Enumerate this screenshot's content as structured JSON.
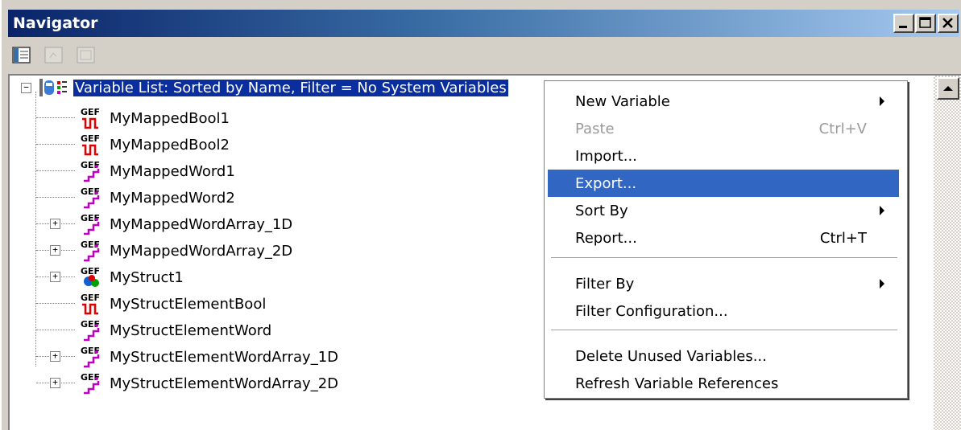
{
  "window": {
    "title": "Navigator",
    "controls": [
      "minimize-icon",
      "maximize-icon",
      "close-icon"
    ]
  },
  "toolbar": {
    "buttons": [
      "tree-view-icon",
      "toolbar-disabled-icon",
      "toolbar-disabled-icon"
    ]
  },
  "tree": {
    "root_label": "Variable List: Sorted by Name, Filter = No System Variables",
    "items": [
      {
        "label": "MyMappedBool1",
        "icon": "bool-variable-icon",
        "expandable": false
      },
      {
        "label": "MyMappedBool2",
        "icon": "bool-variable-icon",
        "expandable": false
      },
      {
        "label": "MyMappedWord1",
        "icon": "word-variable-icon",
        "expandable": false
      },
      {
        "label": "MyMappedWord2",
        "icon": "word-variable-icon",
        "expandable": false
      },
      {
        "label": "MyMappedWordArray_1D",
        "icon": "word-variable-icon",
        "expandable": true
      },
      {
        "label": "MyMappedWordArray_2D",
        "icon": "word-variable-icon",
        "expandable": true
      },
      {
        "label": "MyStruct1",
        "icon": "struct-variable-icon",
        "expandable": true
      },
      {
        "label": "MyStructElementBool",
        "icon": "bool-variable-icon",
        "expandable": false
      },
      {
        "label": "MyStructElementWord",
        "icon": "word-variable-icon",
        "expandable": false
      },
      {
        "label": "MyStructElementWordArray_1D",
        "icon": "word-variable-icon",
        "expandable": true
      },
      {
        "label": "MyStructElementWordArray_2D",
        "icon": "word-variable-icon",
        "expandable": true
      }
    ],
    "icon_text": "GEF"
  },
  "context_menu": {
    "items": [
      {
        "label": "New Variable",
        "shortcut": "",
        "submenu": true,
        "disabled": false,
        "highlighted": false
      },
      {
        "label": "Paste",
        "shortcut": "Ctrl+V",
        "submenu": false,
        "disabled": true,
        "highlighted": false
      },
      {
        "label": "Import...",
        "shortcut": "",
        "submenu": false,
        "disabled": false,
        "highlighted": false
      },
      {
        "label": "Export...",
        "shortcut": "",
        "submenu": false,
        "disabled": false,
        "highlighted": true
      },
      {
        "label": "Sort By",
        "shortcut": "",
        "submenu": true,
        "disabled": false,
        "highlighted": false
      },
      {
        "label": "Report...",
        "shortcut": "Ctrl+T",
        "submenu": false,
        "disabled": false,
        "highlighted": false
      },
      {
        "label": "Filter By",
        "shortcut": "",
        "submenu": true,
        "disabled": false,
        "highlighted": false
      },
      {
        "label": "Filter Configuration...",
        "shortcut": "",
        "submenu": false,
        "disabled": false,
        "highlighted": false
      },
      {
        "label": "Delete Unused Variables...",
        "shortcut": "",
        "submenu": false,
        "disabled": false,
        "highlighted": false
      },
      {
        "label": "Refresh Variable References",
        "shortcut": "",
        "submenu": false,
        "disabled": false,
        "highlighted": false
      }
    ]
  },
  "colors": {
    "title_gradient_start": "#0a246a",
    "title_gradient_end": "#a6caf0",
    "selection": "#0a2e9e",
    "menu_highlight": "#3166c2",
    "bool_signal": "#e00000",
    "word_signal": "#c000c0"
  }
}
